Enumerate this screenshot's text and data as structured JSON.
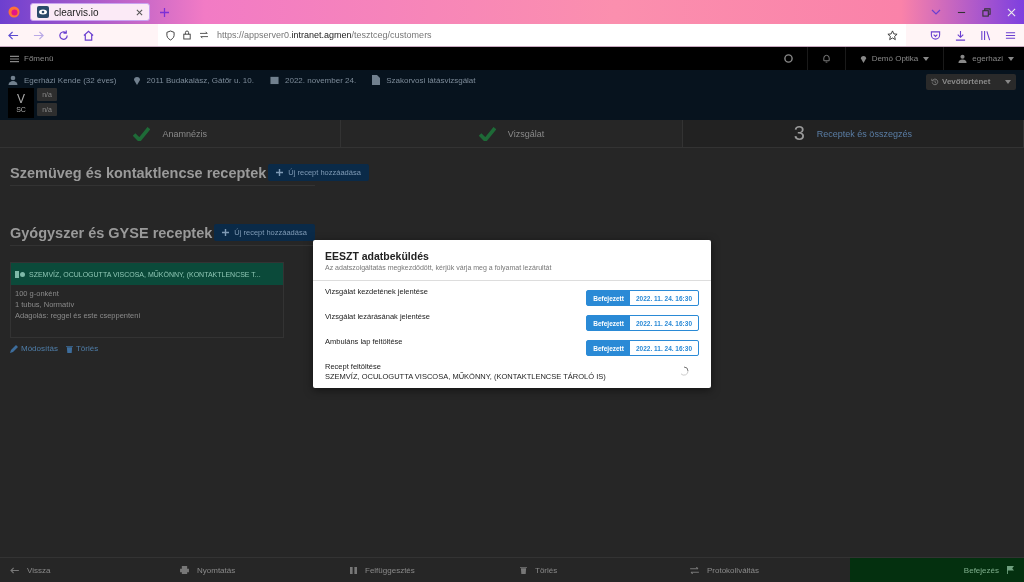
{
  "browser": {
    "tab_title": "clearvis.io",
    "url_prefix": "https://appserver0.",
    "url_host": "intranet.agmen",
    "url_path": "/tesztceg/customers"
  },
  "navbar": {
    "menu": "Főmenü",
    "shop": "Demó Optika",
    "user": "egerhazi"
  },
  "customer": {
    "info": [
      {
        "kind": "person",
        "text": "Egerházi Kende (32 éves)"
      },
      {
        "kind": "pin",
        "text": "2011 Budakalász, Gátőr u. 10."
      },
      {
        "kind": "calendar",
        "text": "2022. november 24."
      },
      {
        "kind": "file",
        "text": "Szakorvosi látásvizsgálat"
      }
    ],
    "badge": {
      "letter": "V",
      "sub": "SC"
    },
    "tags": [
      "n/a",
      "n/a"
    ],
    "history_button": "Vevőtörténet"
  },
  "steps": [
    {
      "label": "Anamnézis",
      "done": true
    },
    {
      "label": "Vizsgálat",
      "done": true
    },
    {
      "label": "Receptek és összegzés",
      "done": false,
      "number": "3"
    }
  ],
  "sections": [
    {
      "title": "Szemüveg és kontaktlencse receptek",
      "button": "Új recept hozzáadása"
    },
    {
      "title": "Gyógyszer és GYSE receptek",
      "button": "Új recept hozzáadása",
      "cards": [
        {
          "title": "SZEMVÍZ, OCULOGUTTA VISCOSA, MŰKÖNNY, (KONTAKTLENCSE T...",
          "lines": [
            "100 g-onként",
            "1 tubus, Normatív",
            "Adagolás: reggel és este cseppenteni"
          ],
          "edit": "Módosítás",
          "delete": "Törlés"
        }
      ]
    }
  ],
  "bottom_bar": [
    {
      "kind": "back",
      "label": "Vissza"
    },
    {
      "kind": "print",
      "label": "Nyomtatás"
    },
    {
      "kind": "pause",
      "label": "Felfüggesztés"
    },
    {
      "kind": "trash",
      "label": "Törlés"
    },
    {
      "kind": "swap",
      "label": "Protokollváltás"
    },
    {
      "kind": "finish",
      "label": "Befejezés"
    }
  ],
  "modal": {
    "title": "EESZT adatbeküldés",
    "subtitle": "Az adatszolgáltatás megkezdődött, kérjük várja meg a folyamat lezárultát",
    "rows": [
      {
        "kind": "done",
        "label": "Vizsgálat kezdetének jelentése",
        "status": "Befejezett",
        "time": "2022. 11. 24. 16:30"
      },
      {
        "kind": "done",
        "label": "Vizsgálat lezárásának jelentése",
        "status": "Befejezett",
        "time": "2022. 11. 24. 16:30"
      },
      {
        "kind": "done",
        "label": "Ambuláns lap feltöltése",
        "status": "Befejezett",
        "time": "2022. 11. 24. 16:30"
      },
      {
        "kind": "pending",
        "label": "Recept feltöltése",
        "detail": "SZEMVÍZ, OCULOGUTTA VISCOSA, MŰKÖNNY, (KONTAKTLENCSE TÁROLÓ IS)"
      }
    ]
  }
}
